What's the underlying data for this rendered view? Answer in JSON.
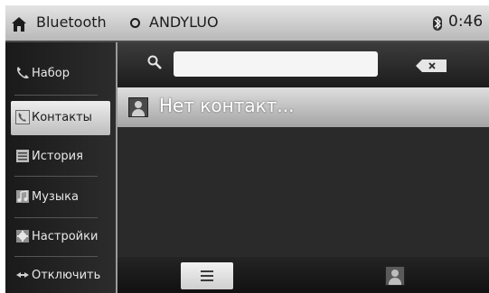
{
  "statusbar": {
    "title": "Bluetooth",
    "device_name": "ANDYLUO",
    "clock": "0:46",
    "icons": [
      "home-icon",
      "device-circle-icon",
      "bluetooth-icon"
    ]
  },
  "sidebar": {
    "items": [
      {
        "label": "Набор",
        "icon": "phone-icon",
        "active": false
      },
      {
        "label": "Контакты",
        "icon": "contacts-phone-icon",
        "active": true
      },
      {
        "label": "История",
        "icon": "history-list-icon",
        "active": false
      },
      {
        "label": "Музыка",
        "icon": "music-icon",
        "active": false
      },
      {
        "label": "Настройки",
        "icon": "settings-gear-icon",
        "active": false
      },
      {
        "label": "Отключить",
        "icon": "disconnect-icon",
        "active": false
      }
    ]
  },
  "search": {
    "value": "",
    "placeholder": ""
  },
  "contacts": {
    "empty_text": "Нет контакт..."
  },
  "bottom_tabs": [
    {
      "name": "list",
      "icon": "list-icon",
      "active": true
    },
    {
      "name": "contacts",
      "icon": "contact-avatar-icon",
      "active": false
    }
  ],
  "colors": {
    "statusbar_bg": "#cfcfcf",
    "main_bg": "#2a2a2a",
    "highlight": "#d8d8d8",
    "text_light": "#e8e8e8"
  }
}
